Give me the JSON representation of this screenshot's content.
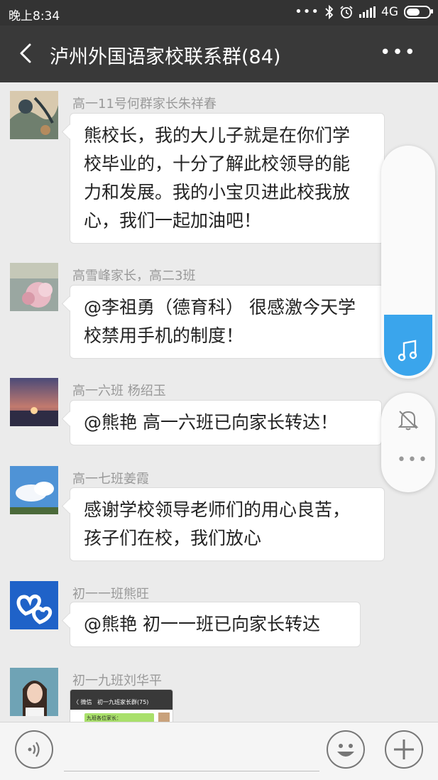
{
  "status_bar": {
    "time": "晚上8:34",
    "network": "4G"
  },
  "header": {
    "title": "泸州外国语家校联系群(84)"
  },
  "messages": [
    {
      "sender": "高一11号何群家长朱祥春",
      "avatar": "floral-painting-avatar",
      "lines": [
        "熊校长，我的大儿子就是在你们学",
        "校毕业的，十分了解此校领导的能",
        "力和发展。我的小宝贝进此校我放",
        "心，我们一起加油吧！"
      ]
    },
    {
      "sender": "高雪峰家长，高二3班",
      "avatar": "pink-flower-avatar",
      "lines": [
        "@李祖勇（德育科） 很感激今天学",
        "校禁用手机的制度！"
      ]
    },
    {
      "sender": "高一六班 杨绍玉",
      "avatar": "sunset-avatar",
      "lines": [
        "@熊艳  高一六班已向家长转达！"
      ]
    },
    {
      "sender": "高一七班姜霞",
      "avatar": "sky-clouds-avatar",
      "lines": [
        "感谢学校领导老师们的用心良苦，",
        "孩子们在校，我们放心"
      ]
    },
    {
      "sender": "初一一班熊旺",
      "avatar": "cloud-hearts-avatar",
      "lines": [
        "@熊艳  初一一班已向家长转达"
      ]
    },
    {
      "sender": "初一九班刘华平",
      "avatar": "girl-photo-avatar",
      "image": {
        "title": "初一九班家长群(75)",
        "back": "〈 微信",
        "preview_text": "九班各位家长："
      }
    }
  ],
  "colors": {
    "header_bg": "#393939",
    "chat_bg": "#ebebeb",
    "accent": "#3aa5ec"
  },
  "music_player": {
    "progress": 0.27
  },
  "input": {
    "placeholder": ""
  }
}
